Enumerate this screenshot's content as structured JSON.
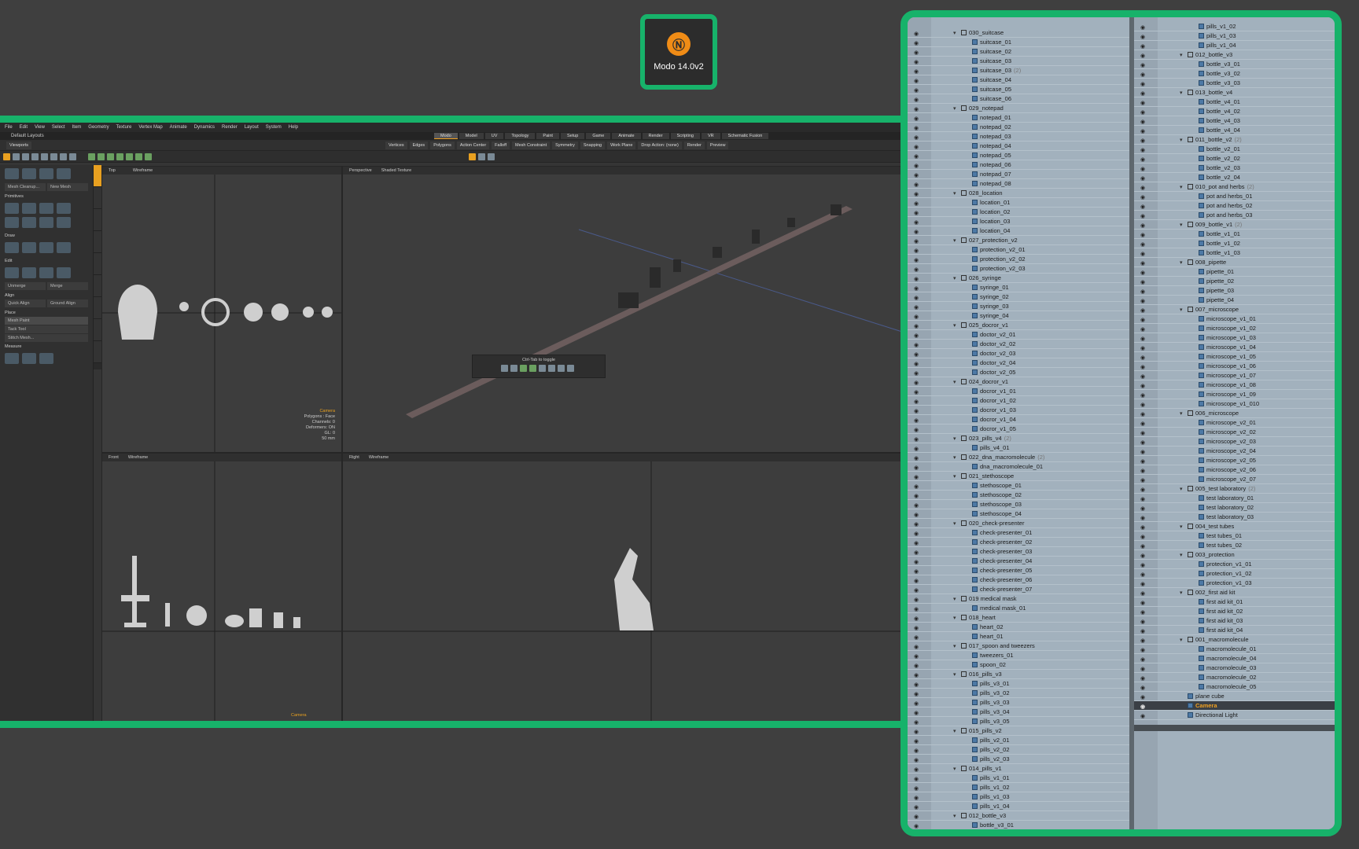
{
  "badge": {
    "title": "Modo 14.0v2",
    "logo_icon": "modo-logo-icon"
  },
  "app": {
    "menu": [
      "File",
      "Edit",
      "View",
      "Select",
      "Item",
      "Geometry",
      "Texture",
      "Vertex Map",
      "Animate",
      "Dynamics",
      "Render",
      "Layout",
      "System",
      "Help"
    ],
    "layout_name": "Default Layouts",
    "layout_tabs": [
      "Modo",
      "Model",
      "UV",
      "Topology",
      "Paint",
      "Setup",
      "Game",
      "Animate",
      "Render",
      "Scripting",
      "VR",
      "Schematic Fusion"
    ],
    "tool_row": {
      "viewports_label": "Viewports",
      "vertices": "Vertices",
      "edges": "Edges",
      "polygons": "Polygons",
      "action_center": "Action Center",
      "falloff": "Falloff",
      "mesh_constraint": "Mesh Constraint",
      "symmetry": "Symmetry",
      "snapping": "Snapping",
      "work_plane": "Work Plane",
      "drop_action": "Drop Action: (none)",
      "render": "Render",
      "preview": "Preview"
    },
    "left_panel": {
      "mesh_cleanup": "Mesh Cleanup...",
      "new_mesh": "New Mesh",
      "primitives": "Primitives",
      "draw": "Draw",
      "edit": "Edit",
      "unmerge": "Unmerge",
      "merge": "Merge",
      "align": "Align",
      "quick_align": "Quick Align",
      "ground_align": "Ground Align",
      "place": "Place",
      "mesh_paint": "Mesh Paint",
      "tack_tool": "Tack Tool",
      "stitch_mesh": "Stitch Mesh...",
      "measure": "Measure"
    },
    "viewports": {
      "top": {
        "view": "Top",
        "shading": "Wireframe"
      },
      "perspective": {
        "view": "Perspective",
        "shading": "Shaded Texture"
      },
      "front": {
        "view": "Front",
        "shading": "Wireframe"
      },
      "right": {
        "view": "Right",
        "shading": "Wireframe"
      },
      "info": [
        "Camera",
        "Polygons : Face",
        "Channels: 0",
        "Deformers: ON",
        "GL: 0",
        "50 mm"
      ],
      "front_camera": "Camera"
    },
    "popup": {
      "title": "Ctrl-Tab to toggle"
    }
  },
  "outliner": {
    "col1": [
      {
        "t": "g",
        "n": "030_suitcase"
      },
      {
        "t": "m",
        "n": "suitcase_01"
      },
      {
        "t": "m",
        "n": "suitcase_02"
      },
      {
        "t": "m",
        "n": "suitcase_03"
      },
      {
        "t": "m",
        "n": "suitcase_03",
        "c": "(2)"
      },
      {
        "t": "m",
        "n": "suitcase_04"
      },
      {
        "t": "m",
        "n": "suitcase_05"
      },
      {
        "t": "m",
        "n": "suitcase_06"
      },
      {
        "t": "g",
        "n": "029_notepad"
      },
      {
        "t": "m",
        "n": "notepad_01"
      },
      {
        "t": "m",
        "n": "notepad_02"
      },
      {
        "t": "m",
        "n": "notepad_03"
      },
      {
        "t": "m",
        "n": "notepad_04"
      },
      {
        "t": "m",
        "n": "notepad_05"
      },
      {
        "t": "m",
        "n": "notepad_06"
      },
      {
        "t": "m",
        "n": "notepad_07"
      },
      {
        "t": "m",
        "n": "notepad_08"
      },
      {
        "t": "g",
        "n": "028_location"
      },
      {
        "t": "m",
        "n": "location_01"
      },
      {
        "t": "m",
        "n": "location_02"
      },
      {
        "t": "m",
        "n": "location_03"
      },
      {
        "t": "m",
        "n": "location_04"
      },
      {
        "t": "g",
        "n": "027_protection_v2"
      },
      {
        "t": "m",
        "n": "protection_v2_01"
      },
      {
        "t": "m",
        "n": "protection_v2_02"
      },
      {
        "t": "m",
        "n": "protection_v2_03"
      },
      {
        "t": "g",
        "n": "026_syringe"
      },
      {
        "t": "m",
        "n": "syringe_01"
      },
      {
        "t": "m",
        "n": "syringe_02"
      },
      {
        "t": "m",
        "n": "syringe_03"
      },
      {
        "t": "m",
        "n": "syringe_04"
      },
      {
        "t": "g",
        "n": "025_docror_v1"
      },
      {
        "t": "m",
        "n": "doctor_v2_01"
      },
      {
        "t": "m",
        "n": "doctor_v2_02"
      },
      {
        "t": "m",
        "n": "doctor_v2_03"
      },
      {
        "t": "m",
        "n": "doctor_v2_04"
      },
      {
        "t": "m",
        "n": "doctor_v2_05"
      },
      {
        "t": "g",
        "n": "024_docror_v1"
      },
      {
        "t": "m",
        "n": "docror_v1_01"
      },
      {
        "t": "m",
        "n": "docror_v1_02"
      },
      {
        "t": "m",
        "n": "docror_v1_03"
      },
      {
        "t": "m",
        "n": "docror_v1_04"
      },
      {
        "t": "m",
        "n": "docror_v1_05"
      },
      {
        "t": "g",
        "n": "023_pills_v4",
        "c": "(2)"
      },
      {
        "t": "m",
        "n": "pills_v4_01"
      },
      {
        "t": "g",
        "n": "022_dna_macromolecule",
        "c": "(2)"
      },
      {
        "t": "m",
        "n": "dna_macromolecule_01"
      },
      {
        "t": "g",
        "n": "021_stethoscope"
      },
      {
        "t": "m",
        "n": "stethoscope_01"
      },
      {
        "t": "m",
        "n": "stethoscope_02"
      },
      {
        "t": "m",
        "n": "stethoscope_03"
      },
      {
        "t": "m",
        "n": "stethoscope_04"
      },
      {
        "t": "g",
        "n": "020_check-presenter"
      },
      {
        "t": "m",
        "n": "check-presenter_01"
      },
      {
        "t": "m",
        "n": "check-presenter_02"
      },
      {
        "t": "m",
        "n": "check-presenter_03"
      },
      {
        "t": "m",
        "n": "check-presenter_04"
      },
      {
        "t": "m",
        "n": "check-presenter_05"
      },
      {
        "t": "m",
        "n": "check-presenter_06"
      },
      {
        "t": "m",
        "n": "check-presenter_07"
      },
      {
        "t": "g",
        "n": "019 medical mask"
      },
      {
        "t": "m",
        "n": "medical mask_01"
      },
      {
        "t": "g",
        "n": "018_heart"
      },
      {
        "t": "m",
        "n": "heart_02"
      },
      {
        "t": "m",
        "n": "heart_01"
      },
      {
        "t": "g",
        "n": "017_spoon and tweezers"
      },
      {
        "t": "m",
        "n": "tweezers_01"
      },
      {
        "t": "m",
        "n": "spoon_02"
      },
      {
        "t": "g",
        "n": "016_pills_v3"
      },
      {
        "t": "m",
        "n": "pills_v3_01"
      },
      {
        "t": "m",
        "n": "pills_v3_02"
      },
      {
        "t": "m",
        "n": "pills_v3_03"
      },
      {
        "t": "m",
        "n": "pills_v3_04"
      },
      {
        "t": "m",
        "n": "pills_v3_05"
      },
      {
        "t": "g",
        "n": "015_pills_v2"
      },
      {
        "t": "m",
        "n": "pills_v2_01"
      },
      {
        "t": "m",
        "n": "pills_v2_02"
      },
      {
        "t": "m",
        "n": "pills_v2_03"
      },
      {
        "t": "g",
        "n": "014_pills_v1"
      },
      {
        "t": "m",
        "n": "pills_v1_01"
      },
      {
        "t": "m",
        "n": "pills_v1_02"
      },
      {
        "t": "m",
        "n": "pills_v1_03"
      },
      {
        "t": "m",
        "n": "pills_v1_04"
      },
      {
        "t": "g",
        "n": "012_bottle_v3"
      },
      {
        "t": "m",
        "n": "bottle_v3_01"
      }
    ],
    "col2": [
      {
        "t": "m",
        "n": "pills_v1_02"
      },
      {
        "t": "m",
        "n": "pills_v1_03"
      },
      {
        "t": "m",
        "n": "pills_v1_04"
      },
      {
        "t": "g",
        "n": "012_bottle_v3"
      },
      {
        "t": "m",
        "n": "bottle_v3_01"
      },
      {
        "t": "m",
        "n": "bottle_v3_02"
      },
      {
        "t": "m",
        "n": "bottle_v3_03"
      },
      {
        "t": "g",
        "n": "013_bottle_v4"
      },
      {
        "t": "m",
        "n": "bottle_v4_01"
      },
      {
        "t": "m",
        "n": "bottle_v4_02"
      },
      {
        "t": "m",
        "n": "bottle_v4_03"
      },
      {
        "t": "m",
        "n": "bottle_v4_04"
      },
      {
        "t": "g",
        "n": "011_bottle_v2",
        "c": "(2)"
      },
      {
        "t": "m",
        "n": "bottle_v2_01"
      },
      {
        "t": "m",
        "n": "bottle_v2_02"
      },
      {
        "t": "m",
        "n": "bottle_v2_03"
      },
      {
        "t": "m",
        "n": "bottle_v2_04"
      },
      {
        "t": "g",
        "n": "010_pot and herbs",
        "c": "(2)"
      },
      {
        "t": "m",
        "n": "pot and herbs_01"
      },
      {
        "t": "m",
        "n": "pot and herbs_02"
      },
      {
        "t": "m",
        "n": "pot and herbs_03"
      },
      {
        "t": "g",
        "n": "009_bottle_v1",
        "c": "(2)"
      },
      {
        "t": "m",
        "n": "bottle_v1_01"
      },
      {
        "t": "m",
        "n": "bottle_v1_02"
      },
      {
        "t": "m",
        "n": "bottle_v1_03"
      },
      {
        "t": "g",
        "n": "008_pipette"
      },
      {
        "t": "m",
        "n": "pipette_01"
      },
      {
        "t": "m",
        "n": "pipette_02"
      },
      {
        "t": "m",
        "n": "pipette_03"
      },
      {
        "t": "m",
        "n": "pipette_04"
      },
      {
        "t": "g",
        "n": "007_microscope"
      },
      {
        "t": "m",
        "n": "microscope_v1_01"
      },
      {
        "t": "m",
        "n": "microscope_v1_02"
      },
      {
        "t": "m",
        "n": "microscope_v1_03"
      },
      {
        "t": "m",
        "n": "microscope_v1_04"
      },
      {
        "t": "m",
        "n": "microscope_v1_05"
      },
      {
        "t": "m",
        "n": "microscope_v1_06"
      },
      {
        "t": "m",
        "n": "microscope_v1_07"
      },
      {
        "t": "m",
        "n": "microscope_v1_08"
      },
      {
        "t": "m",
        "n": "microscope_v1_09"
      },
      {
        "t": "m",
        "n": "microscope_v1_010"
      },
      {
        "t": "g",
        "n": "006_microscope"
      },
      {
        "t": "m",
        "n": "microscope_v2_01"
      },
      {
        "t": "m",
        "n": "microscope_v2_02"
      },
      {
        "t": "m",
        "n": "microscope_v2_03"
      },
      {
        "t": "m",
        "n": "microscope_v2_04"
      },
      {
        "t": "m",
        "n": "microscope_v2_05"
      },
      {
        "t": "m",
        "n": "microscope_v2_06"
      },
      {
        "t": "m",
        "n": "microscope_v2_07"
      },
      {
        "t": "g",
        "n": "005_test laboratory",
        "c": "(2)"
      },
      {
        "t": "m",
        "n": "test laboratory_01"
      },
      {
        "t": "m",
        "n": "test laboratory_02"
      },
      {
        "t": "m",
        "n": "test laboratory_03"
      },
      {
        "t": "g",
        "n": "004_test tubes"
      },
      {
        "t": "m",
        "n": "test tubes_01"
      },
      {
        "t": "m",
        "n": "test tubes_02"
      },
      {
        "t": "g",
        "n": "003_protection"
      },
      {
        "t": "m",
        "n": "protection_v1_01"
      },
      {
        "t": "m",
        "n": "protection_v1_02"
      },
      {
        "t": "m",
        "n": "protection_v1_03"
      },
      {
        "t": "g",
        "n": "002_first aid kit"
      },
      {
        "t": "m",
        "n": "first aid kit_01"
      },
      {
        "t": "m",
        "n": "first aid kit_02"
      },
      {
        "t": "m",
        "n": "first aid kit_03"
      },
      {
        "t": "m",
        "n": "first aid kit_04"
      },
      {
        "t": "g",
        "n": "001_macromolecule"
      },
      {
        "t": "m",
        "n": "macromolecule_01"
      },
      {
        "t": "m",
        "n": "macromolecule_04"
      },
      {
        "t": "m",
        "n": "macromolecule_03"
      },
      {
        "t": "m",
        "n": "macromolecule_02"
      },
      {
        "t": "m",
        "n": "macromolecule_05"
      },
      {
        "t": "r",
        "n": "plane cube"
      },
      {
        "t": "s",
        "n": "Camera"
      },
      {
        "t": "r",
        "n": "Directional Light"
      }
    ]
  },
  "colors": {
    "accent": "#17b26a",
    "selection": "#f0a020",
    "modo_logo": "#f08c16"
  }
}
